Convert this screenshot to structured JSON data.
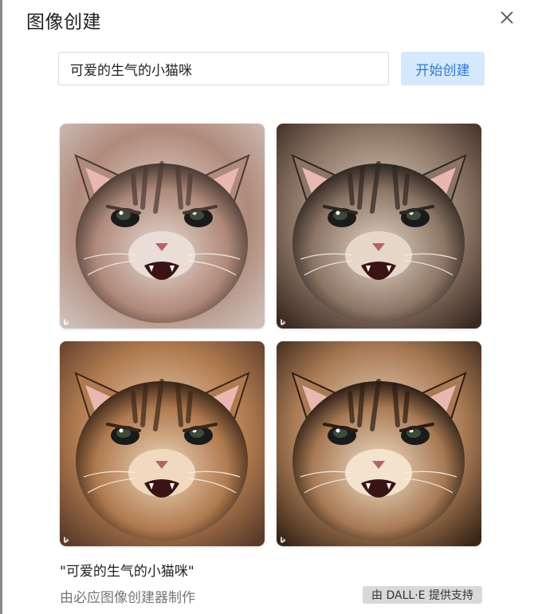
{
  "dialog": {
    "title": "图像创建",
    "close_icon": "close-icon"
  },
  "prompt": {
    "value": "可爱的生气的小猫咪",
    "button_label": "开始创建"
  },
  "images": [
    {
      "alt": "kitten-1",
      "fur": "#b08a7a",
      "dark": "#4a3a34",
      "light": "#e9ddd6",
      "bg": "#cdbfb8"
    },
    {
      "alt": "kitten-2",
      "fur": "#8c7565",
      "dark": "#2f2621",
      "light": "#e6d7c9",
      "bg": "#3a2a22"
    },
    {
      "alt": "kitten-3",
      "fur": "#b07a4f",
      "dark": "#3b2618",
      "light": "#f0d9bf",
      "bg": "#5a3b2a"
    },
    {
      "alt": "kitten-4",
      "fur": "#a87a54",
      "dark": "#2b1d14",
      "light": "#f3e2cc",
      "bg": "#3a2618"
    }
  ],
  "caption": {
    "title": "\"可爱的生气的小猫咪\"",
    "subtitle": "由必应图像创建器制作",
    "powered_by": "由 DALL·E 提供支持"
  },
  "colors": {
    "accent": "#2f7ad1",
    "button_bg": "#d6e8fb"
  }
}
